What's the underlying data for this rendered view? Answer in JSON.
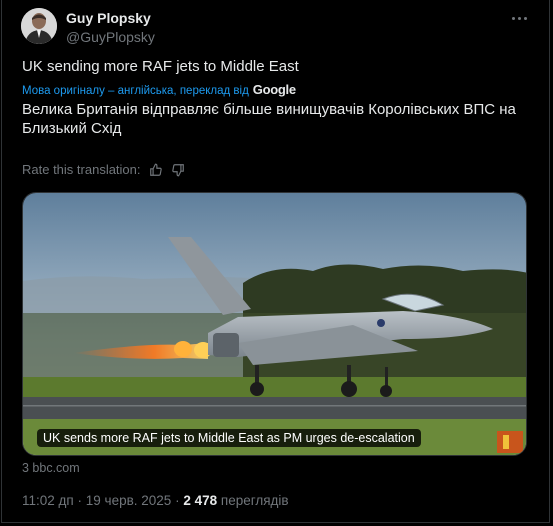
{
  "author": {
    "name": "Guy Plopsky",
    "handle": "@GuyPlopsky"
  },
  "tweet": {
    "text": "UK sending more RAF jets to Middle East",
    "translation_note": "Мова оригіналу – англійська, переклад від",
    "translation_provider": "Google",
    "translated_text": "Велика Британія відправляє більше винищувачів Королівських ВПС на Близький Схід",
    "rate_label": "Rate this translation:"
  },
  "card": {
    "caption": "UK sends more RAF jets to Middle East as PM urges de-escalation",
    "domain": "3 bbc.com"
  },
  "meta": {
    "time": "11:02 дп",
    "date": "19 черв. 2025",
    "separator": "·",
    "views_count": "2 478",
    "views_label": "переглядів"
  },
  "icons": {
    "more": "more-horizontal-icon",
    "thumb_up": "thumbs-up-icon",
    "thumb_down": "thumbs-down-icon"
  },
  "colors": {
    "background": "#000000",
    "text": "#e7e9ea",
    "muted": "#71767b",
    "link": "#1d9bf0",
    "border": "#2f3336"
  }
}
